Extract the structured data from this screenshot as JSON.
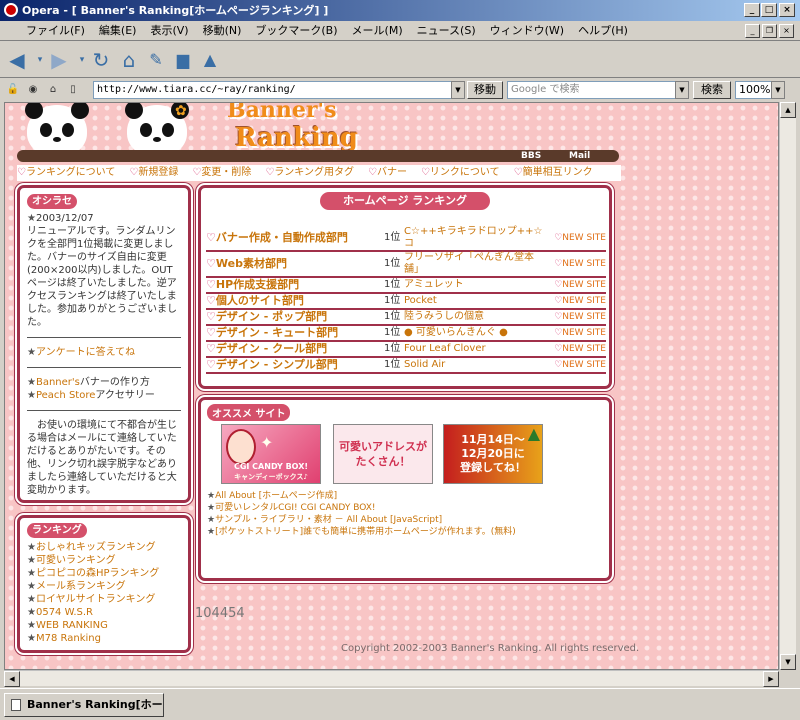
{
  "window": {
    "title": "Opera - [ Banner's Ranking[ホームページランキング] ]"
  },
  "menu": [
    "ファイル(F)",
    "編集(E)",
    "表示(V)",
    "移動(N)",
    "ブックマーク(B)",
    "メール(M)",
    "ニュース(S)",
    "ウィンドウ(W)",
    "ヘルプ(H)"
  ],
  "address": {
    "url": "http://www.tiara.cc/~ray/ranking/",
    "go_label": "移動",
    "search_placeholder": "Google で検索",
    "search_label": "検索",
    "zoom": "100%"
  },
  "header": {
    "logo_top": "Banner's",
    "logo_main": "Ranking",
    "bar_links": [
      "BBS",
      "Mail"
    ],
    "nav": [
      "ランキングについて",
      "新規登録",
      "変更・削除",
      "ランキング用タグ",
      "バナー",
      "リンクについて",
      "簡単相互リンク"
    ]
  },
  "news": {
    "heading": "オシラセ",
    "date": "2003/12/07",
    "text": "リニューアルです。ランダムリンクを全部門1位掲載に変更しました。バナーのサイズ自由に変更(200×200以内)しました。OUTページは終了いたしました。逆アクセスランキングは終了いたしました。参加ありがとうございました。",
    "survey": "アンケートに答えてね",
    "credit1_site": "Banner's",
    "credit1_text": "バナーの作り方",
    "credit2_site": "Peach Store",
    "credit2_text": "アクセサリー",
    "notice": "お使いの環境にて不都合が生じる場合はメールにて連絡していただけるとありがたいです。その他、リンク切れ誤字脱字などありましたら連絡していただけると大変助かります。"
  },
  "ranking_side": {
    "heading": "ランキング",
    "items": [
      "おしゃれキッズランキング",
      "可愛いランキング",
      "ピコピコの森HPランキング",
      "メール系ランキング",
      "ロイヤルサイトランキング",
      "0574 W.S.R",
      "WEB RANKING",
      "M78 Ranking"
    ]
  },
  "rank_table": {
    "heading": "ホームページ ランキング",
    "rows": [
      {
        "cat": "バナー作成・自動作成部門",
        "pos": "1位",
        "site": "C☆++キラキラドロップ++☆コ",
        "new": "NEW SITE"
      },
      {
        "cat": "Web素材部門",
        "pos": "1位",
        "site": "フリーソザイ「ぺんぎん堂本舗」",
        "new": "NEW SITE"
      },
      {
        "cat": "HP作成支援部門",
        "pos": "1位",
        "site": "アミュレット",
        "new": "NEW SITE"
      },
      {
        "cat": "個人のサイト部門",
        "pos": "1位",
        "site": "Pocket",
        "new": "NEW SITE"
      },
      {
        "cat": "デザイン - ポップ部門",
        "pos": "1位",
        "site": "陸うみうしの個意",
        "new": "NEW SITE"
      },
      {
        "cat": "デザイン - キュート部門",
        "pos": "1位",
        "site": "● 可愛いらんきんぐ ●",
        "new": "NEW SITE"
      },
      {
        "cat": "デザイン - クール部門",
        "pos": "1位",
        "site": "Four Leaf Clover",
        "new": "NEW SITE"
      },
      {
        "cat": "デザイン - シンプル部門",
        "pos": "1位",
        "site": "Solid Air",
        "new": "NEW SITE"
      }
    ]
  },
  "recommend": {
    "heading": "オススメ サイト",
    "banner1_top": "CGI CANDY BOX!",
    "banner1_bottom": "キャンディーボックス♪",
    "banner2": "可愛いアドレスがたくさん！",
    "banner3_line1": "11月14日～",
    "banner3_line2": "12月20日に",
    "banner3_line3": "登録してね！",
    "links": [
      "All About [ホームページ作成]",
      "可愛いレンタルCGI!  CGI CANDY BOX!",
      "サンプル・ライブラリ・素材 － All About [JavaScript]",
      "[ポケットストリート]誰でも簡単に携帯用ホームページが作れます。(無料)"
    ]
  },
  "footer": {
    "counter": "104454",
    "copyright": "Copyright 2002-2003 Banner's Ranking. All rights reserved."
  },
  "statusbar": {
    "tab": "Banner's Ranking[ホー..."
  }
}
